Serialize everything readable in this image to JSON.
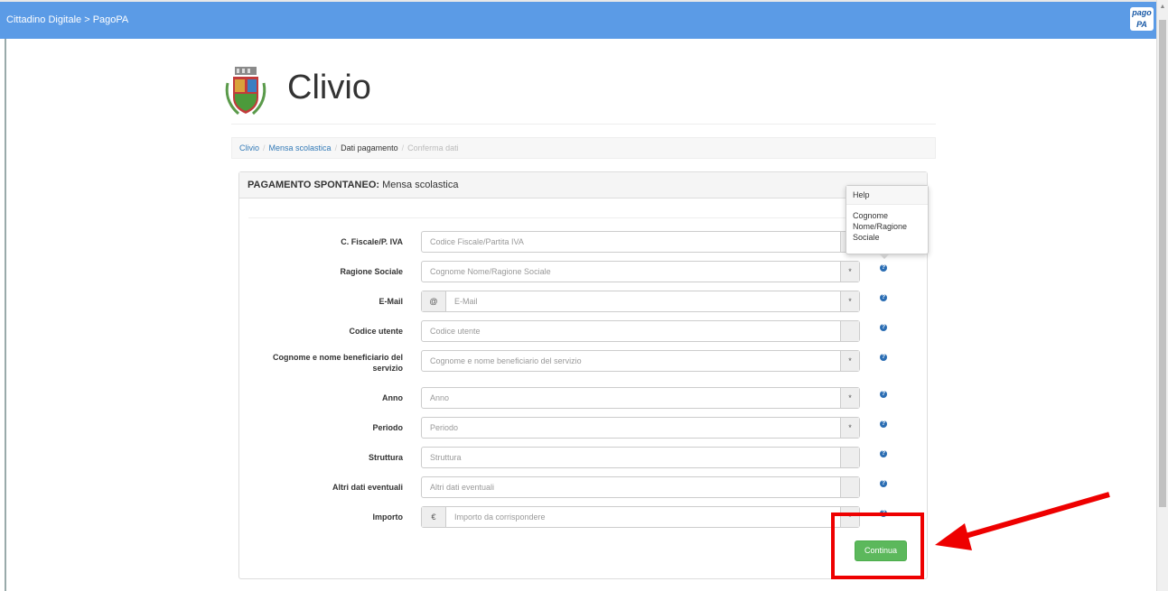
{
  "app": {
    "title": "Cittadino Digitale > PagoPA",
    "logo_text": "pagoPA"
  },
  "header": {
    "city": "Clivio"
  },
  "breadcrumb": [
    {
      "label": "Clivio"
    },
    {
      "label": "Mensa scolastica"
    },
    {
      "label": "Dati pagamento"
    },
    {
      "label": "Conferma dati"
    }
  ],
  "panel": {
    "title_bold": "PAGAMENTO SPONTANEO:",
    "title_rest": " Mensa scolastica"
  },
  "fields": [
    {
      "label": "C. Fiscale/P. IVA",
      "placeholder": "Codice Fiscale/Partita IVA",
      "addon_left": "",
      "addon_right": ""
    },
    {
      "label": "Ragione Sociale",
      "placeholder": "Cognome Nome/Ragione Sociale",
      "addon_left": "",
      "addon_right": "*"
    },
    {
      "label": "E-Mail",
      "placeholder": "E-Mail",
      "addon_left": "@",
      "addon_right": "*"
    },
    {
      "label": "Codice utente",
      "placeholder": "Codice utente",
      "addon_left": "",
      "addon_right": ""
    },
    {
      "label": "Cognome e nome beneficiario del servizio",
      "placeholder": "Cognome e nome beneficiario del servizio",
      "addon_left": "",
      "addon_right": "*"
    },
    {
      "label": "Anno",
      "placeholder": "Anno",
      "addon_left": "",
      "addon_right": "*"
    },
    {
      "label": "Periodo",
      "placeholder": "Periodo",
      "addon_left": "",
      "addon_right": "*"
    },
    {
      "label": "Struttura",
      "placeholder": "Struttura",
      "addon_left": "",
      "addon_right": ""
    },
    {
      "label": "Altri dati eventuali",
      "placeholder": "Altri dati eventuali",
      "addon_left": "",
      "addon_right": ""
    },
    {
      "label": "Importo",
      "placeholder": "Importo da corrispondere",
      "addon_left": "€",
      "addon_right": "*"
    }
  ],
  "popover": {
    "title": "Help",
    "body": "Cognome Nome/Ragione Sociale"
  },
  "continue_label": "Continua",
  "colors": {
    "topbar": "#5b9be6",
    "continue": "#5cb85c",
    "highlight": "#ee0000",
    "help_icon": "#2a6db3"
  }
}
